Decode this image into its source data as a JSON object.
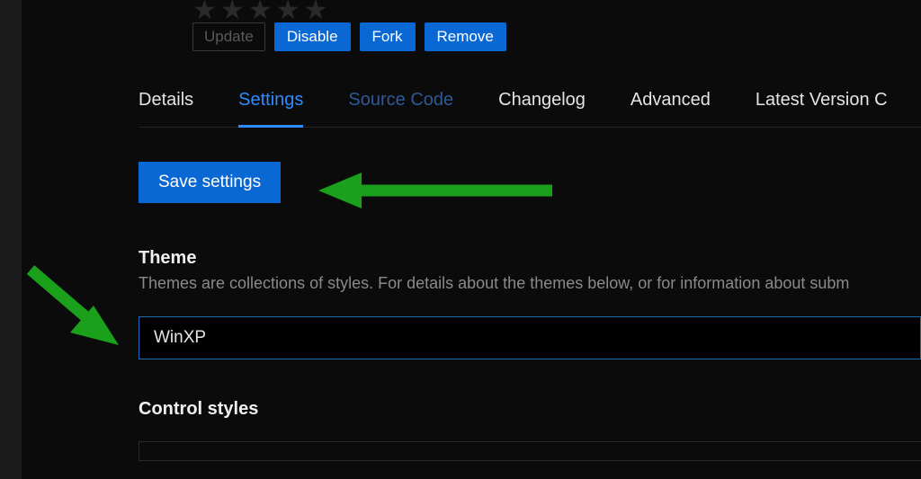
{
  "stars": "★★★★★",
  "actions": {
    "update": "Update",
    "disable": "Disable",
    "fork": "Fork",
    "remove": "Remove"
  },
  "tabs": {
    "details": "Details",
    "settings": "Settings",
    "source_code": "Source Code",
    "changelog": "Changelog",
    "advanced": "Advanced",
    "latest": "Latest Version C"
  },
  "settings": {
    "save_label": "Save settings",
    "theme_title": "Theme",
    "theme_desc": "Themes are collections of styles. For details about the themes below, or for information about subm",
    "theme_value": "WinXP",
    "control_styles_title": "Control styles"
  },
  "colors": {
    "accent": "#0a68d4",
    "accent_light": "#2d8cff",
    "arrow": "#1aa01a"
  }
}
